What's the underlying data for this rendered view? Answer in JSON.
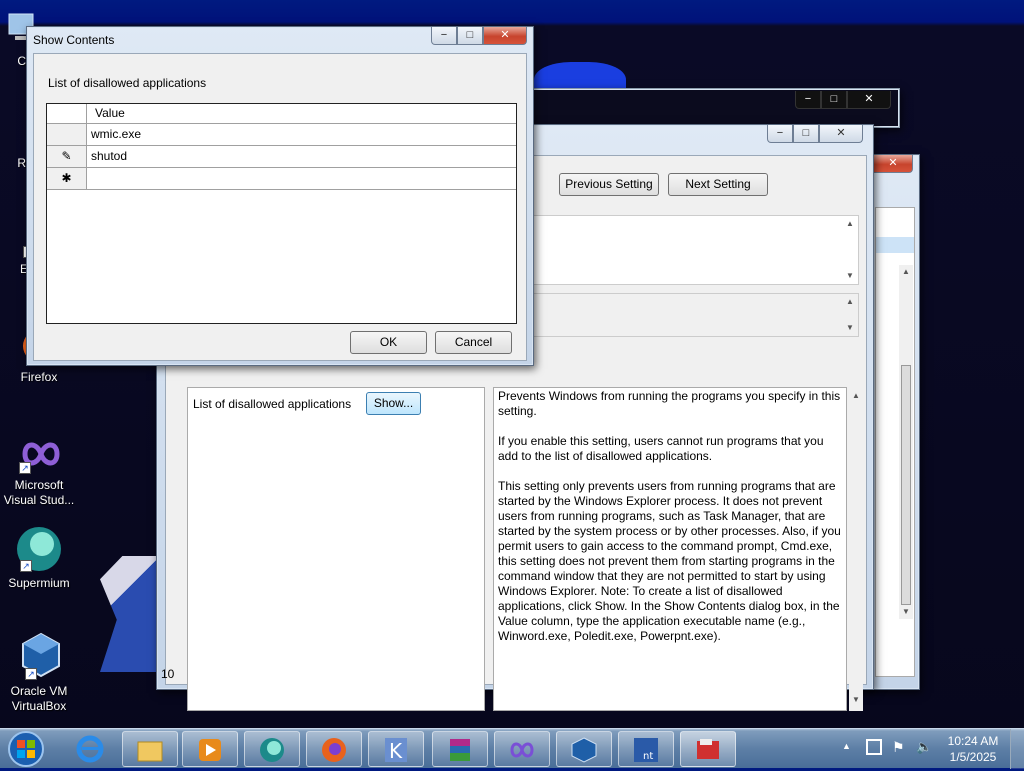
{
  "desktop": {
    "icons": [
      {
        "label": "Co"
      },
      {
        "label": "Re"
      },
      {
        "label": "Ev"
      },
      {
        "label": "Firefox"
      },
      {
        "label": "Microsoft Visual Stud..."
      },
      {
        "label": "Supermium"
      },
      {
        "label": "Oracle VM VirtualBox"
      }
    ]
  },
  "show_contents": {
    "title": "Show Contents",
    "list_label": "List of disallowed applications",
    "column_header": "Value",
    "rows": [
      {
        "marker": "",
        "value": "wmic.exe"
      },
      {
        "marker": "✎",
        "value": "shutod"
      },
      {
        "marker": "✱",
        "value": ""
      }
    ],
    "ok_label": "OK",
    "cancel_label": "Cancel"
  },
  "policy_dialog": {
    "previous_label": "Previous Setting",
    "next_label": "Next Setting",
    "options_label": "List of disallowed applications",
    "show_label": "Show...",
    "help_text": "Prevents Windows from running the programs you specify in this setting.\n\nIf you enable this setting, users cannot run programs that you add to the list of disallowed applications.\n\nThis setting only prevents users from running programs that are started by the Windows Explorer process. It does not prevent users from running programs, such as Task Manager, that are started by the system process or by other processes. Also, if you permit users to gain access to the command prompt, Cmd.exe, this setting does not prevent them from starting programs in the command window that they are not permitted to start by using Windows Explorer. Note: To create a list of disallowed applications, click Show. In the Show Contents dialog box, in the Value column, type the application executable name (e.g., Winword.exe, Poledit.exe, Powerpnt.exe).",
    "partial_text": "10"
  },
  "taskbar": {
    "time": "10:24 AM",
    "date": "1/5/2025"
  },
  "colors": {
    "desktop": "#07071c",
    "taskbar": "#5d7fa6",
    "close_button": "#c7442d"
  }
}
